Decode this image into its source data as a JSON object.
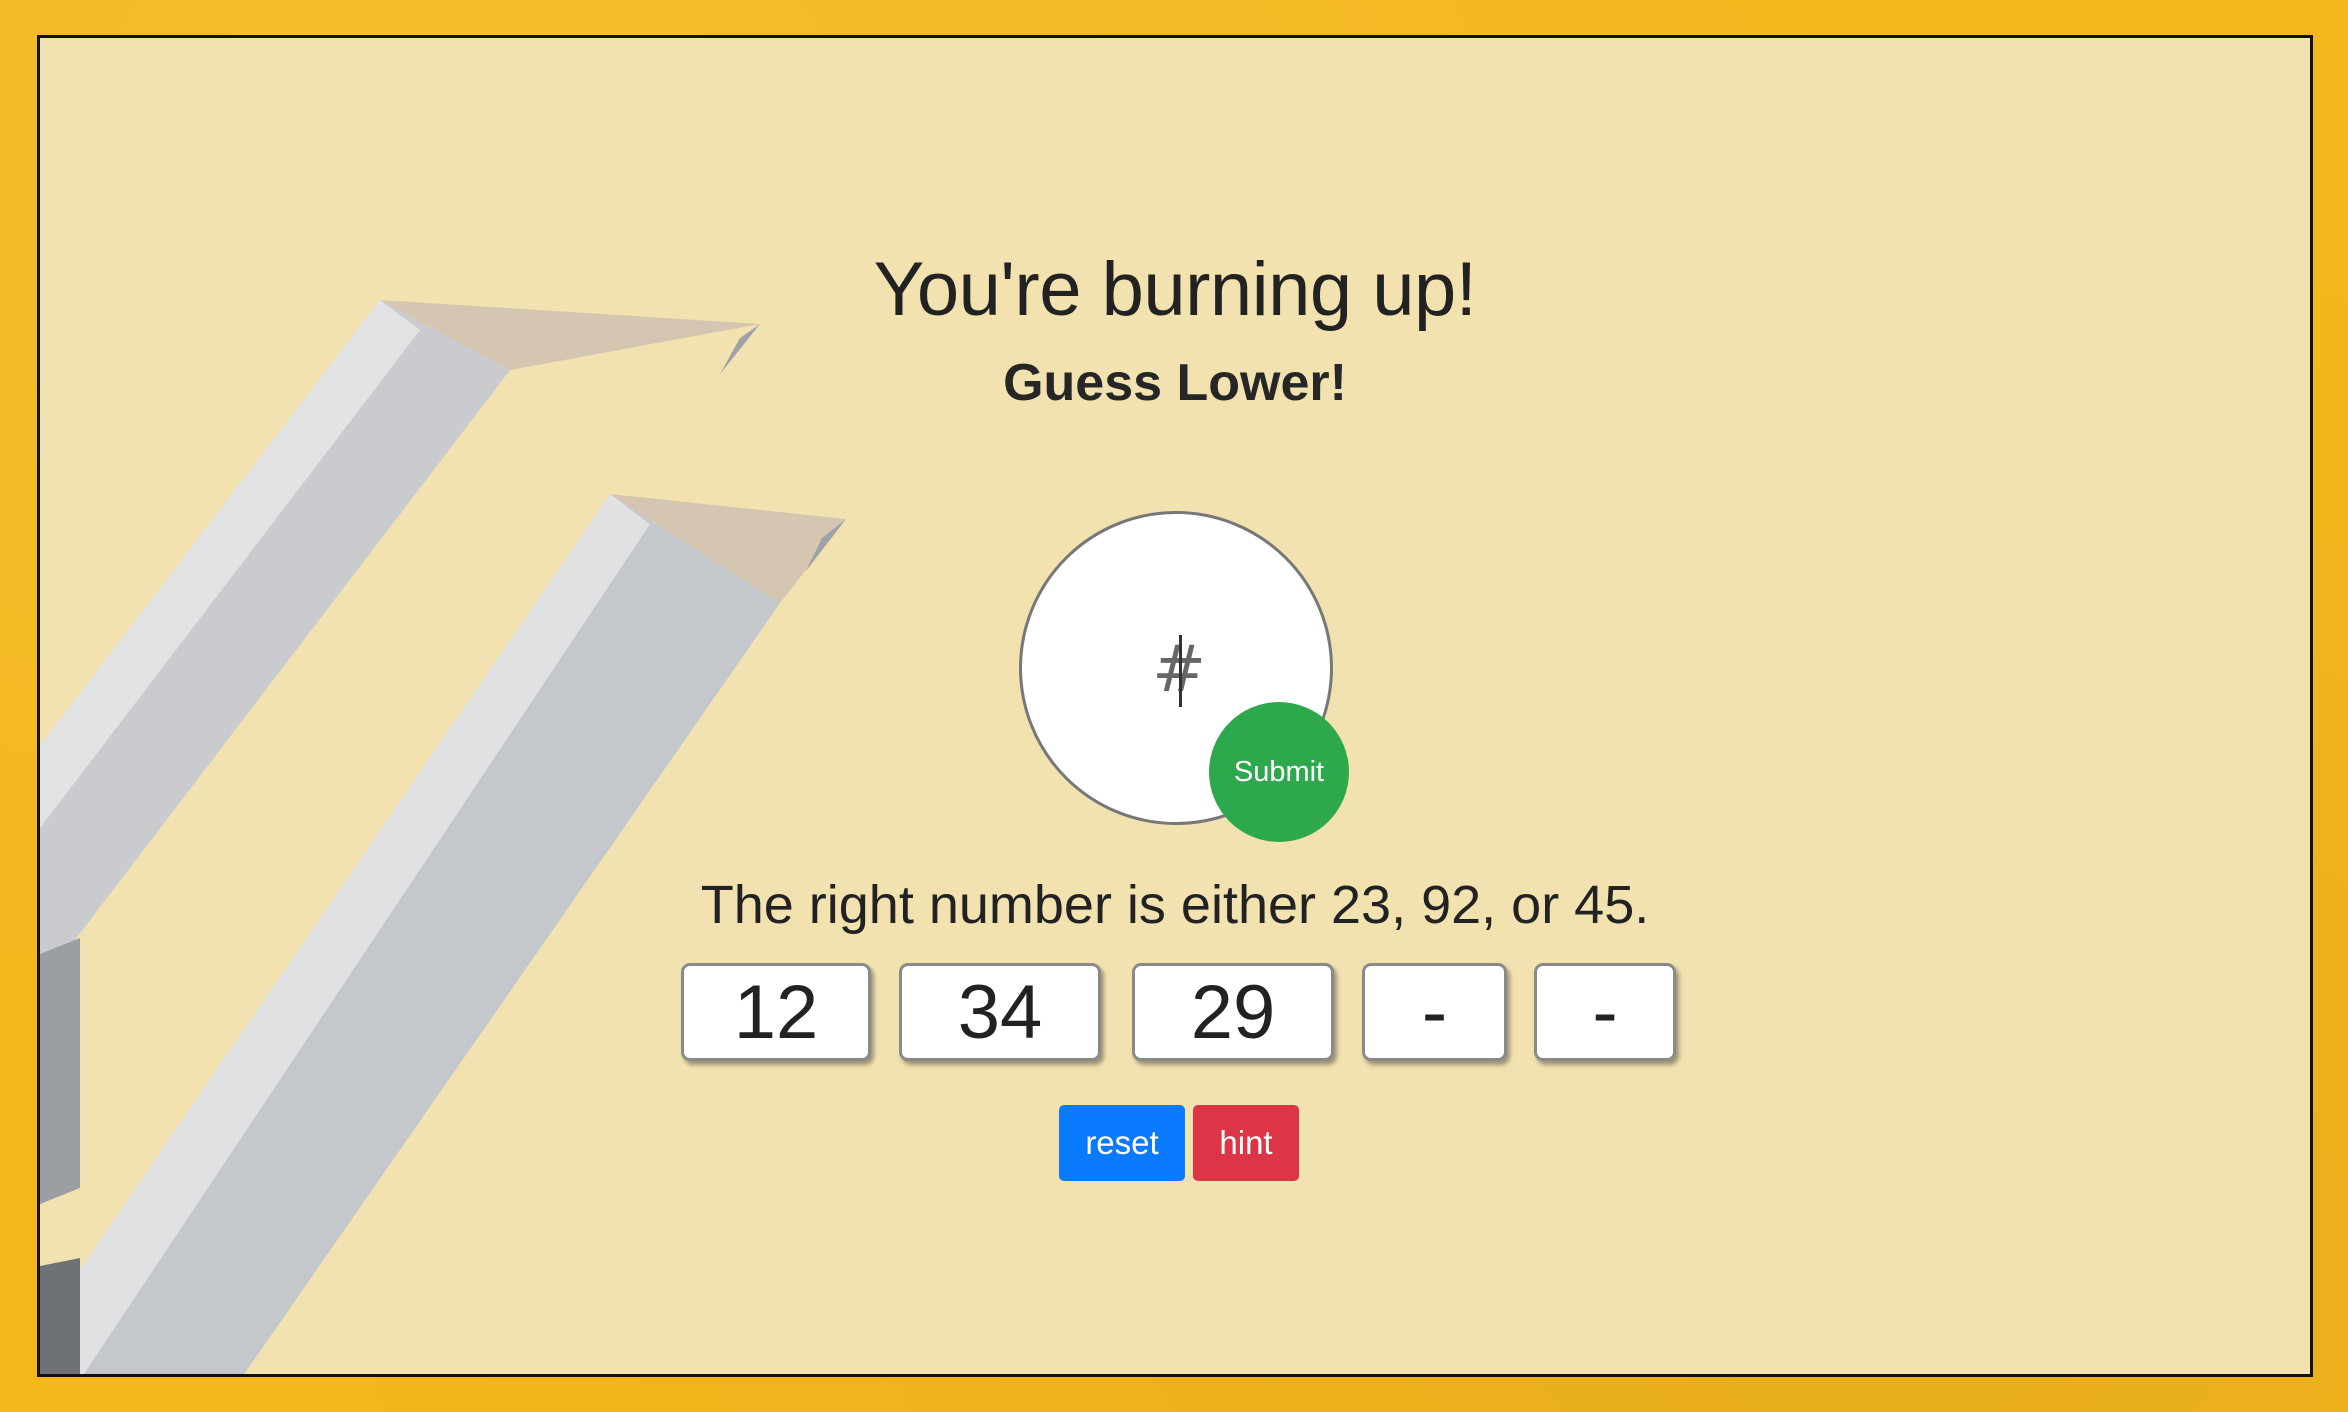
{
  "game": {
    "headline": "You're burning up!",
    "direction": "Guess Lower!",
    "guess_placeholder": "#",
    "submit_label": "Submit",
    "hint_text": "The right number is either 23, 92, or 45.",
    "previous_guesses": [
      "12",
      "34",
      "29",
      "-",
      "-"
    ],
    "reset_label": "reset",
    "hint_label": "hint"
  },
  "colors": {
    "frame": "#f4b71c",
    "card": "#f1e2b0",
    "submit": "#2ea84d",
    "reset": "#0a7bff",
    "hint": "#dc3545"
  },
  "icons": {
    "background": "pencils-photo"
  }
}
